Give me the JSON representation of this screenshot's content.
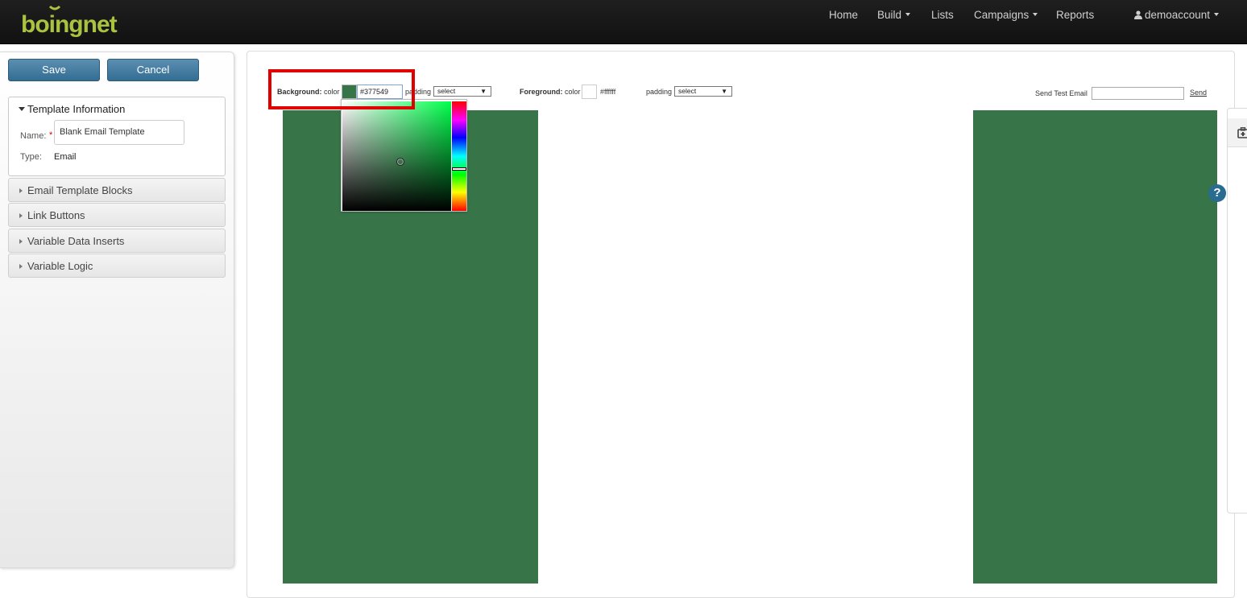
{
  "brand": {
    "logo_text": "boingnet"
  },
  "nav": {
    "home": "Home",
    "build": "Build",
    "lists": "Lists",
    "campaigns": "Campaigns",
    "reports": "Reports",
    "account": "demoaccount"
  },
  "sidebar": {
    "save_label": "Save",
    "cancel_label": "Cancel",
    "template_info": {
      "title": "Template Information",
      "name_label": "Name:",
      "name_value": "Blank Email Template",
      "type_label": "Type:",
      "type_value": "Email"
    },
    "sections": [
      {
        "label": "Email Template Blocks"
      },
      {
        "label": "Link Buttons"
      },
      {
        "label": "Variable Data Inserts"
      },
      {
        "label": "Variable Logic"
      }
    ]
  },
  "toolbar": {
    "background_label": "Background:",
    "color_label": "color",
    "background_hex": "#377549",
    "padding_label": "padding",
    "padding_value": "select",
    "foreground_label": "Foreground:",
    "foreground_hex": "#ffffff",
    "send_test_label": "Send Test Email",
    "send_test_value": "",
    "send_label": "Send"
  },
  "colors": {
    "background": "#377549",
    "foreground": "#ffffff",
    "accent": "#336d92"
  },
  "icons": [
    "user-icon",
    "caret-down-icon",
    "help-icon",
    "toolbox-icon"
  ]
}
